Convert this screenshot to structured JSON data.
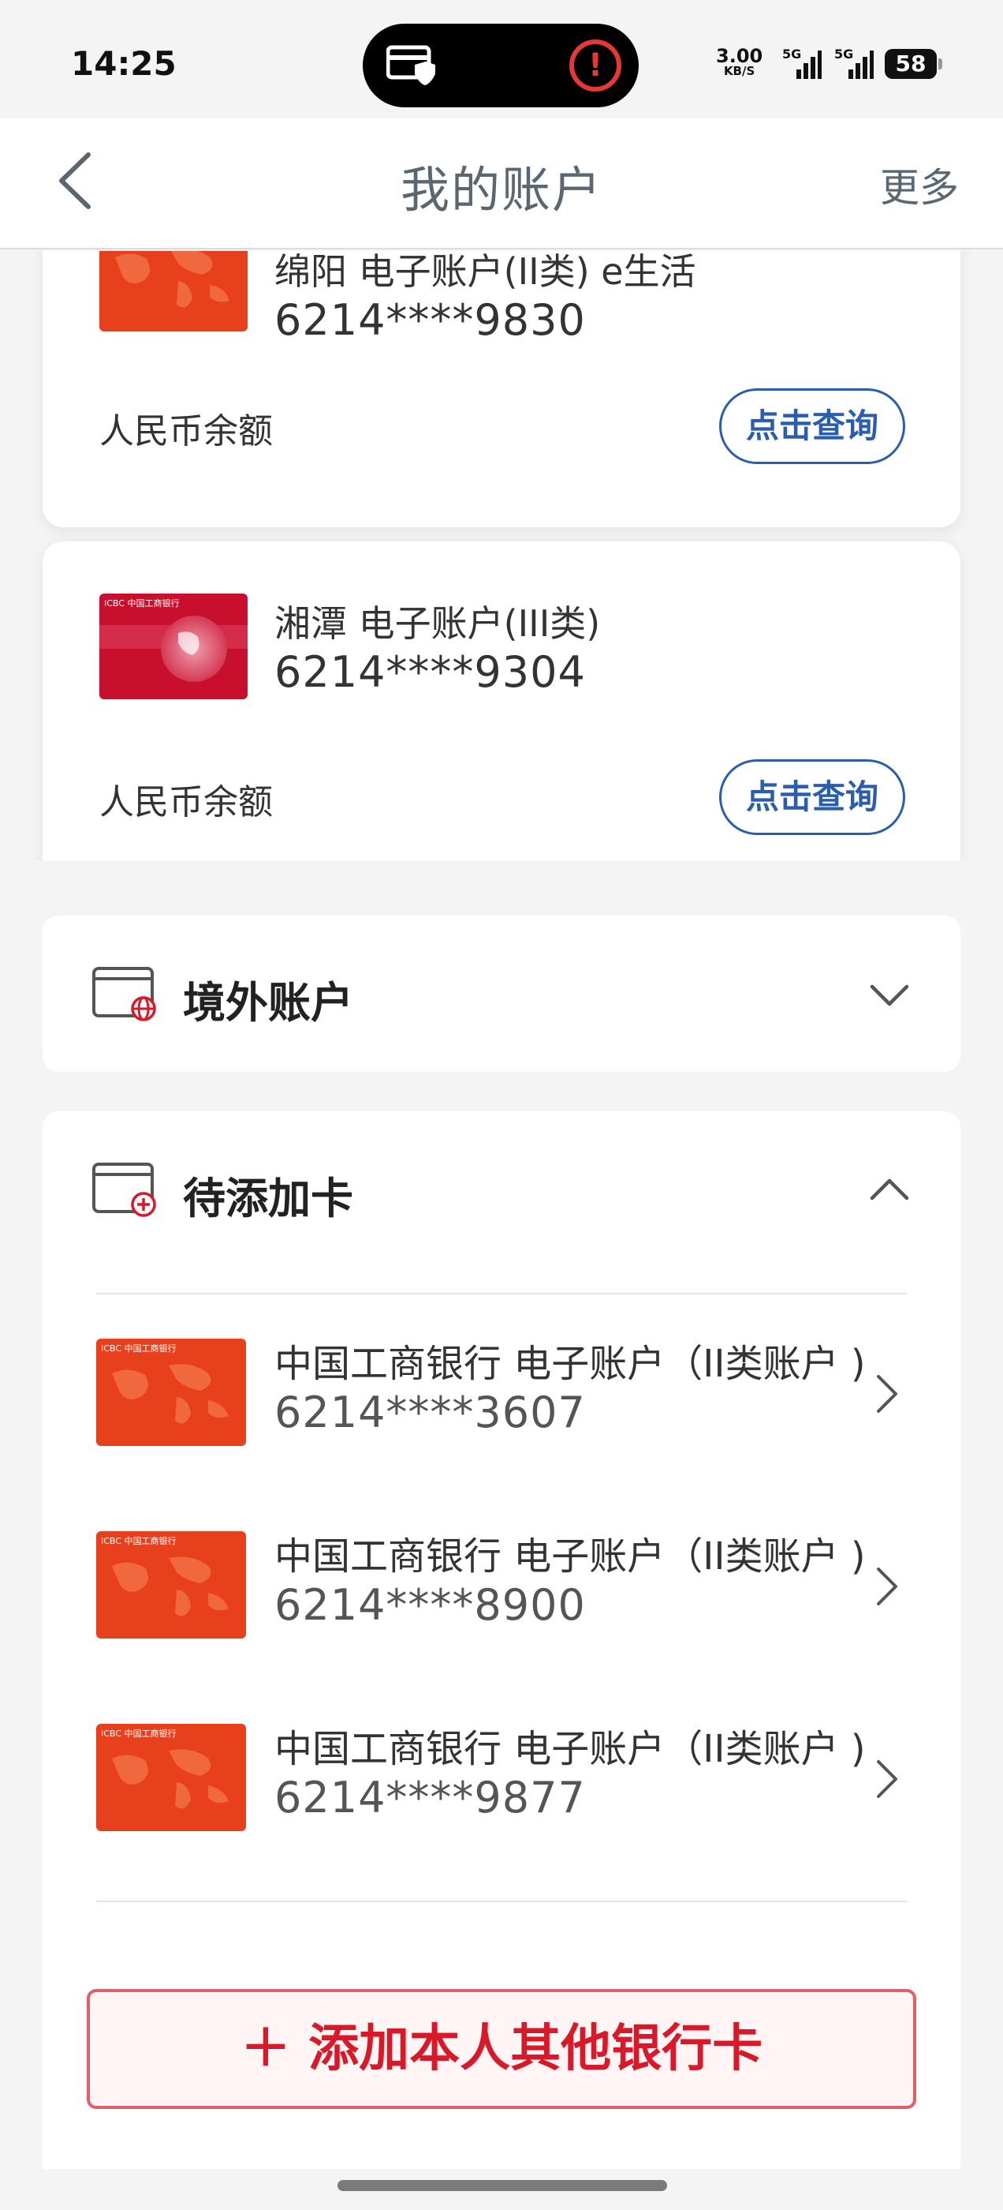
{
  "status_bar": {
    "time": "14:25",
    "net_speed": "3.00",
    "net_speed_unit": "KB/S",
    "signal1_label": "5G",
    "signal2_label": "5G",
    "battery": "58"
  },
  "navbar": {
    "title": "我的账户",
    "more": "更多"
  },
  "accounts": [
    {
      "name": "绵阳 电子账户(II类) e生活",
      "number": "6214****9830",
      "balance_label": "人民币余额",
      "query_label": "点击查询"
    },
    {
      "name": "湘潭 电子账户(III类)",
      "number": "6214****9304",
      "balance_label": "人民币余额",
      "query_label": "点击查询"
    }
  ],
  "sections": {
    "overseas": {
      "title": "境外账户",
      "expanded": false
    },
    "pending": {
      "title": "待添加卡",
      "expanded": true
    }
  },
  "pending_cards": [
    {
      "name": "中国工商银行 电子账户（II类账户 )",
      "number": "6214****3607"
    },
    {
      "name": "中国工商银行 电子账户（II类账户 )",
      "number": "6214****8900"
    },
    {
      "name": "中国工商银行 电子账户（II类账户 )",
      "number": "6214****9877"
    }
  ],
  "add_button": {
    "label": "＋ 添加本人其他银行卡"
  },
  "colors": {
    "accent_blue": "#2a5db0",
    "accent_red": "#d8192a",
    "card_red": "#e8401c"
  },
  "card_brand_mark": "ICBC 中国工商银行"
}
